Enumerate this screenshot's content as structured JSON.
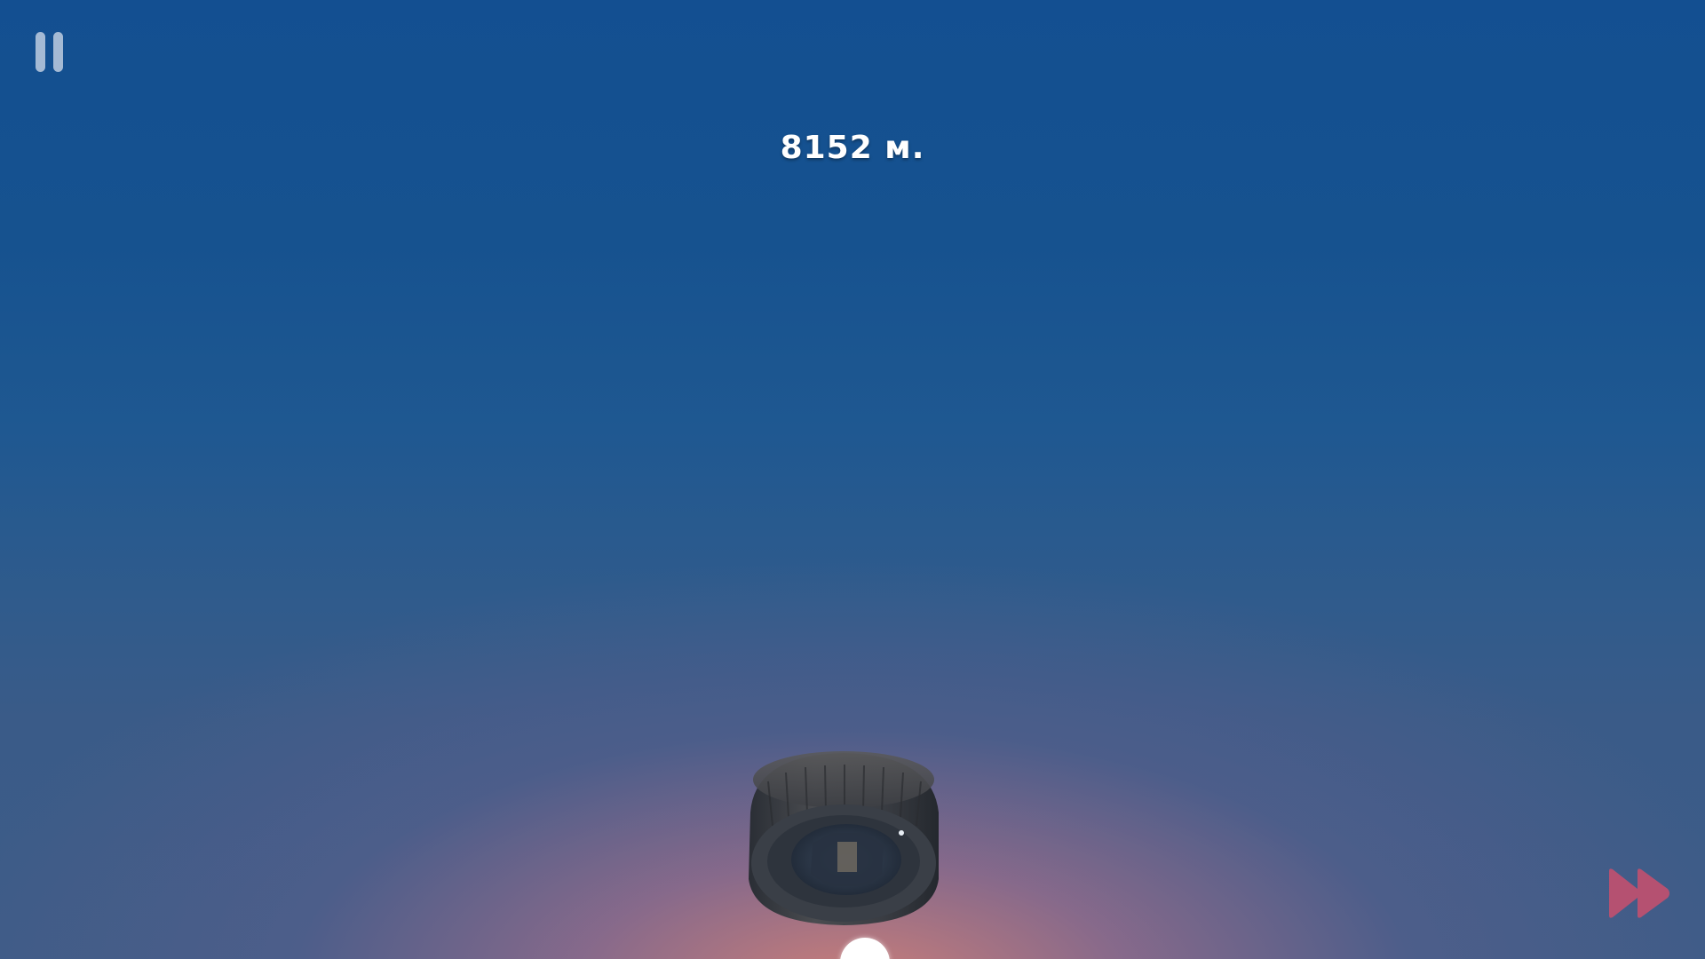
{
  "hud": {
    "distance_text": "8152 м.",
    "pause_icon": "pause-icon",
    "fast_forward_icon": "fast-forward-icon"
  },
  "scene": {
    "player_object": "tire",
    "sky_top_color": "#134f91",
    "sky_horizon_color": "#d28078",
    "fast_forward_color": "#c2506f"
  }
}
